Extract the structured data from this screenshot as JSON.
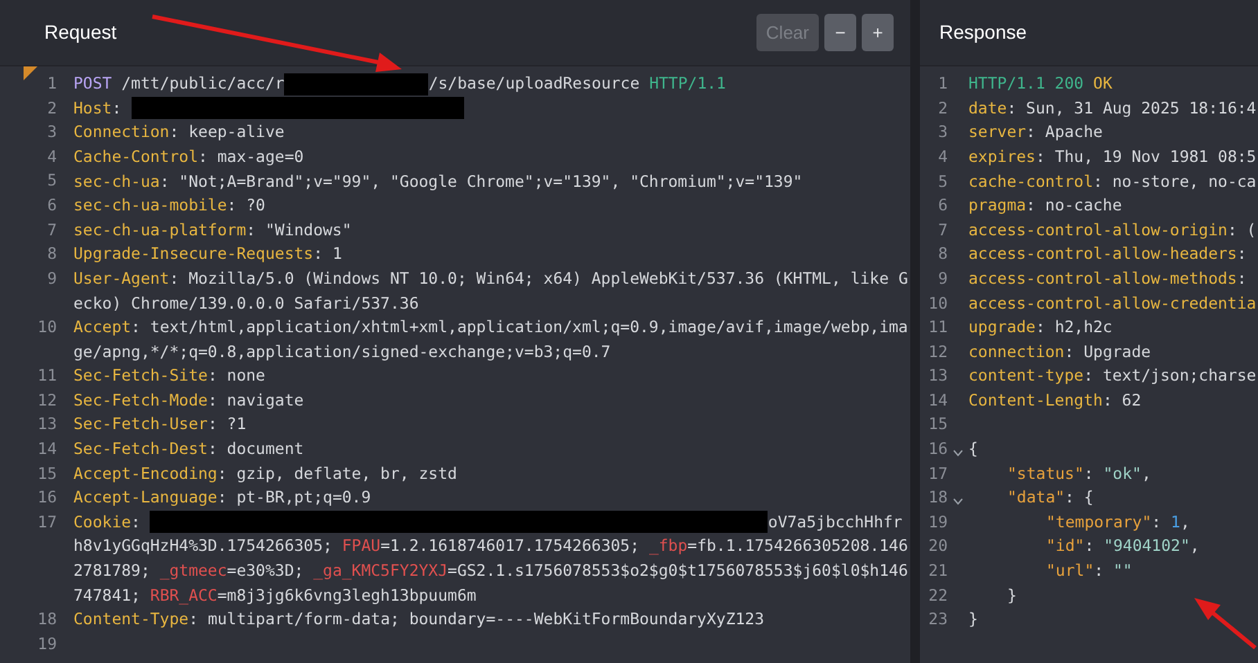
{
  "request": {
    "title": "Request",
    "buttons": [
      {
        "label": "Clear",
        "disabled": true
      },
      {
        "label": "−",
        "disabled": false
      },
      {
        "label": "+",
        "disabled": false
      }
    ],
    "lines": [
      {
        "number": "1",
        "rows": [
          {
            "segments": [
              {
                "kind": "method",
                "text": "POST"
              },
              {
                "kind": "value",
                "text": " /mtt/public/acc/r"
              },
              {
                "kind": "redaction-short"
              },
              {
                "kind": "value",
                "text": "/s/base/uploadResource "
              },
              {
                "kind": "proto",
                "text": "HTTP/1.1"
              }
            ]
          }
        ]
      },
      {
        "number": "2",
        "rows": [
          {
            "segments": [
              {
                "kind": "key",
                "text": "Host"
              },
              {
                "kind": "value",
                "text": ": "
              },
              {
                "kind": "redaction-medium"
              }
            ]
          }
        ]
      },
      {
        "number": "3",
        "rows": [
          {
            "segments": [
              {
                "kind": "key",
                "text": "Connection"
              },
              {
                "kind": "value",
                "text": ": keep-alive"
              }
            ]
          }
        ]
      },
      {
        "number": "4",
        "rows": [
          {
            "segments": [
              {
                "kind": "key",
                "text": "Cache-Control"
              },
              {
                "kind": "value",
                "text": ": max-age=0"
              }
            ]
          }
        ]
      },
      {
        "number": "5",
        "rows": [
          {
            "segments": [
              {
                "kind": "key",
                "text": "sec-ch-ua"
              },
              {
                "kind": "value",
                "text": ": \"Not;A=Brand\";v=\"99\", \"Google Chrome\";v=\"139\", \"Chromium\";v=\"139\""
              }
            ]
          }
        ]
      },
      {
        "number": "6",
        "rows": [
          {
            "segments": [
              {
                "kind": "key",
                "text": "sec-ch-ua-mobile"
              },
              {
                "kind": "value",
                "text": ": ?0"
              }
            ]
          }
        ]
      },
      {
        "number": "7",
        "rows": [
          {
            "segments": [
              {
                "kind": "key",
                "text": "sec-ch-ua-platform"
              },
              {
                "kind": "value",
                "text": ": \"Windows\""
              }
            ]
          }
        ]
      },
      {
        "number": "8",
        "rows": [
          {
            "segments": [
              {
                "kind": "key",
                "text": "Upgrade-Insecure-Requests"
              },
              {
                "kind": "value",
                "text": ": 1"
              }
            ]
          }
        ]
      },
      {
        "number": "9",
        "rows": [
          {
            "segments": [
              {
                "kind": "key",
                "text": "User-Agent"
              },
              {
                "kind": "value",
                "text": ": Mozilla/5.0 (Windows NT 10.0; Win64; x64) AppleWebKit/537.36 (KHTML, like G"
              }
            ]
          },
          {
            "segments": [
              {
                "kind": "value",
                "text": "ecko) Chrome/139.0.0.0 Safari/537.36"
              }
            ]
          }
        ]
      },
      {
        "number": "10",
        "rows": [
          {
            "segments": [
              {
                "kind": "key",
                "text": "Accept"
              },
              {
                "kind": "value",
                "text": ": text/html,application/xhtml+xml,application/xml;q=0.9,image/avif,image/webp,ima"
              }
            ]
          },
          {
            "segments": [
              {
                "kind": "value",
                "text": "ge/apng,*/*;q=0.8,application/signed-exchange;v=b3;q=0.7"
              }
            ]
          }
        ]
      },
      {
        "number": "11",
        "rows": [
          {
            "segments": [
              {
                "kind": "key",
                "text": "Sec-Fetch-Site"
              },
              {
                "kind": "value",
                "text": ": none"
              }
            ]
          }
        ]
      },
      {
        "number": "12",
        "rows": [
          {
            "segments": [
              {
                "kind": "key",
                "text": "Sec-Fetch-Mode"
              },
              {
                "kind": "value",
                "text": ": navigate"
              }
            ]
          }
        ]
      },
      {
        "number": "13",
        "rows": [
          {
            "segments": [
              {
                "kind": "key",
                "text": "Sec-Fetch-User"
              },
              {
                "kind": "value",
                "text": ": ?1"
              }
            ]
          }
        ]
      },
      {
        "number": "14",
        "rows": [
          {
            "segments": [
              {
                "kind": "key",
                "text": "Sec-Fetch-Dest"
              },
              {
                "kind": "value",
                "text": ": document"
              }
            ]
          }
        ]
      },
      {
        "number": "15",
        "rows": [
          {
            "segments": [
              {
                "kind": "key",
                "text": "Accept-Encoding"
              },
              {
                "kind": "value",
                "text": ": gzip, deflate, br, zstd"
              }
            ]
          }
        ]
      },
      {
        "number": "16",
        "rows": [
          {
            "segments": [
              {
                "kind": "key",
                "text": "Accept-Language"
              },
              {
                "kind": "value",
                "text": ": pt-BR,pt;q=0.9"
              }
            ]
          }
        ]
      },
      {
        "number": "17",
        "rows": [
          {
            "segments": [
              {
                "kind": "key",
                "text": "Cookie"
              },
              {
                "kind": "value",
                "text": ": "
              },
              {
                "kind": "redaction-long"
              },
              {
                "kind": "value",
                "text": "oV7a5jbcchHhfr"
              }
            ]
          },
          {
            "segments": [
              {
                "kind": "value",
                "text": "h8v1yGGqHzH4%3D.1754266305; "
              },
              {
                "kind": "cookie",
                "text": "FPAU"
              },
              {
                "kind": "value",
                "text": "=1.2.1618746017.1754266305; "
              },
              {
                "kind": "cookie",
                "text": "_fbp"
              },
              {
                "kind": "value",
                "text": "=fb.1.1754266305208.146"
              }
            ]
          },
          {
            "segments": [
              {
                "kind": "value",
                "text": "2781789; "
              },
              {
                "kind": "cookie",
                "text": "_gtmeec"
              },
              {
                "kind": "value",
                "text": "=e30%3D; "
              },
              {
                "kind": "cookie",
                "text": "_ga_KMC5FY2YXJ"
              },
              {
                "kind": "value",
                "text": "=GS2.1.s1756078553$o2$g0$t1756078553$j60$l0$h146"
              }
            ]
          },
          {
            "segments": [
              {
                "kind": "value",
                "text": "747841; "
              },
              {
                "kind": "cookie",
                "text": "RBR_ACC"
              },
              {
                "kind": "value",
                "text": "=m8j3jg6k6vng3legh13bpuum6m"
              }
            ]
          }
        ]
      },
      {
        "number": "18",
        "rows": [
          {
            "segments": [
              {
                "kind": "key",
                "text": "Content-Type"
              },
              {
                "kind": "value",
                "text": ": multipart/form-data; boundary=----WebKitFormBoundaryXyZ123"
              }
            ]
          }
        ]
      },
      {
        "number": "19"
      }
    ]
  },
  "response": {
    "title": "Response",
    "lines": [
      {
        "number": "1",
        "segments": [
          {
            "kind": "proto",
            "text": "HTTP/1.1 200 "
          },
          {
            "kind": "status",
            "text": "OK"
          }
        ]
      },
      {
        "number": "2",
        "segments": [
          {
            "kind": "key",
            "text": "date"
          },
          {
            "kind": "value",
            "text": ": Sun, 31 Aug 2025 18:16:4"
          }
        ]
      },
      {
        "number": "3",
        "segments": [
          {
            "kind": "key",
            "text": "server"
          },
          {
            "kind": "value",
            "text": ": Apache"
          }
        ]
      },
      {
        "number": "4",
        "segments": [
          {
            "kind": "key",
            "text": "expires"
          },
          {
            "kind": "value",
            "text": ": Thu, 19 Nov 1981 08:5"
          }
        ]
      },
      {
        "number": "5",
        "segments": [
          {
            "kind": "key",
            "text": "cache-control"
          },
          {
            "kind": "value",
            "text": ": no-store, no-ca"
          }
        ]
      },
      {
        "number": "6",
        "segments": [
          {
            "kind": "key",
            "text": "pragma"
          },
          {
            "kind": "value",
            "text": ": no-cache"
          }
        ]
      },
      {
        "number": "7",
        "segments": [
          {
            "kind": "key",
            "text": "access-control-allow-origin"
          },
          {
            "kind": "value",
            "text": ": ("
          }
        ]
      },
      {
        "number": "8",
        "segments": [
          {
            "kind": "key",
            "text": "access-control-allow-headers"
          },
          {
            "kind": "value",
            "text": ":"
          }
        ]
      },
      {
        "number": "9",
        "segments": [
          {
            "kind": "key",
            "text": "access-control-allow-methods"
          },
          {
            "kind": "value",
            "text": ":"
          }
        ]
      },
      {
        "number": "10",
        "segments": [
          {
            "kind": "key",
            "text": "access-control-allow-credentia"
          }
        ]
      },
      {
        "number": "11",
        "segments": [
          {
            "kind": "key",
            "text": "upgrade"
          },
          {
            "kind": "value",
            "text": ": h2,h2c"
          }
        ]
      },
      {
        "number": "12",
        "segments": [
          {
            "kind": "key",
            "text": "connection"
          },
          {
            "kind": "value",
            "text": ": Upgrade"
          }
        ]
      },
      {
        "number": "13",
        "segments": [
          {
            "kind": "key",
            "text": "content-type"
          },
          {
            "kind": "value",
            "text": ": text/json;charse"
          }
        ]
      },
      {
        "number": "14",
        "segments": [
          {
            "kind": "key",
            "text": "Content-Length"
          },
          {
            "kind": "value",
            "text": ": 62"
          }
        ]
      },
      {
        "number": "15"
      },
      {
        "number": "16",
        "expanded": true,
        "segments": [
          {
            "kind": "value",
            "text": "{"
          }
        ],
        "children": [
          {
            "number": "17",
            "segments": [
              {
                "kind": "json-key",
                "text": "\"status\""
              },
              {
                "kind": "value",
                "text": ": "
              },
              {
                "kind": "json-str",
                "text": "\"ok\""
              },
              {
                "kind": "value",
                "text": ","
              }
            ]
          },
          {
            "number": "18",
            "expanded": true,
            "segments": [
              {
                "kind": "json-key",
                "text": "\"data\""
              },
              {
                "kind": "value",
                "text": ": {"
              }
            ],
            "children": [
              {
                "number": "19",
                "segments": [
                  {
                    "kind": "json-key",
                    "text": "\"temporary\""
                  },
                  {
                    "kind": "value",
                    "text": ": "
                  },
                  {
                    "kind": "json-num",
                    "text": "1"
                  },
                  {
                    "kind": "value",
                    "text": ","
                  }
                ]
              },
              {
                "number": "20",
                "segments": [
                  {
                    "kind": "json-key",
                    "text": "\"id\""
                  },
                  {
                    "kind": "value",
                    "text": ": "
                  },
                  {
                    "kind": "json-str",
                    "text": "\"9404102\""
                  },
                  {
                    "kind": "value",
                    "text": ","
                  }
                ]
              },
              {
                "number": "21",
                "segments": [
                  {
                    "kind": "json-key",
                    "text": "\"url\""
                  },
                  {
                    "kind": "value",
                    "text": ": "
                  },
                  {
                    "kind": "json-str",
                    "text": "\"\""
                  }
                ]
              }
            ]
          },
          {
            "number": "22",
            "segments": [
              {
                "kind": "value",
                "text": "}"
              }
            ]
          }
        ]
      },
      {
        "number": "23",
        "segments": [
          {
            "kind": "value",
            "text": "}"
          }
        ]
      }
    ]
  }
}
